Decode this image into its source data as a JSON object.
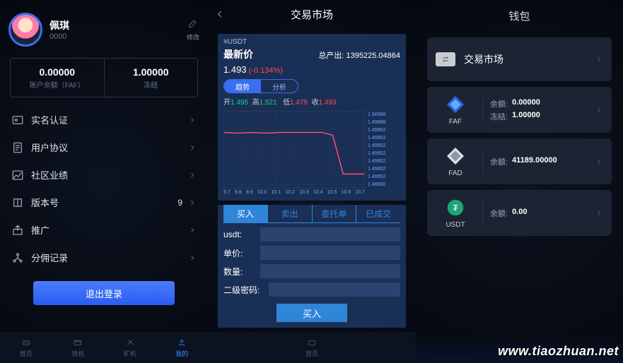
{
  "screen1": {
    "user_name": "佩琪",
    "user_id": "0000",
    "edit_label": "修改",
    "balance_value": "0.00000",
    "balance_label": "账户余额（FAF）",
    "frozen_value": "1.00000",
    "frozen_label": "冻结",
    "menu": [
      {
        "label": "实名认证"
      },
      {
        "label": "用户协议"
      },
      {
        "label": "社区业绩"
      },
      {
        "label": "版本号",
        "badge": "9"
      },
      {
        "label": "推广"
      },
      {
        "label": "分佣记录"
      }
    ],
    "logout_label": "退出登录",
    "tabs": [
      "首页",
      "钱包",
      "矿机",
      "我的"
    ]
  },
  "screen2": {
    "title": "交易市场",
    "pair": "USDT",
    "latest_label": "最新价",
    "output_label": "总产出:",
    "output_value": "1395225.04864",
    "price": "1.493",
    "pct": "(-0.134%)",
    "seg": [
      "趋势",
      "分析"
    ],
    "ohlc": {
      "o_lab": "开",
      "o": "1.495",
      "h_lab": "高",
      "h": "1.521",
      "l_lab": "低",
      "l": "1.479",
      "c_lab": "收",
      "c": "1.493"
    },
    "trade_tabs": [
      "买入",
      "卖出",
      "委托单",
      "已成交"
    ],
    "fields": [
      "usdt:",
      "单价:",
      "数量:",
      "二级密码:"
    ],
    "buy_label": "买入",
    "tabs": [
      "首页"
    ]
  },
  "chart_data": {
    "type": "line",
    "x": [
      "9.7",
      "9.8",
      "9.9",
      "10.0",
      "10.1",
      "10.2",
      "10.3",
      "10.4",
      "10.5",
      "10.6",
      "10.7"
    ],
    "series": [
      {
        "name": "price",
        "values": [
          1.501,
          1.5005,
          1.501,
          1.5008,
          1.501,
          1.501,
          1.501,
          1.501,
          1.499,
          1.48,
          1.48
        ]
      }
    ],
    "y_ticks": [
      "1.50988",
      "1.49988",
      "1.49952",
      "1.49952",
      "1.49952",
      "1.49952",
      "1.49952",
      "1.49952",
      "1.49952",
      "1.48000"
    ],
    "ylim": [
      1.475,
      1.512
    ]
  },
  "screen3": {
    "title": "钱包",
    "market_label": "交易市场",
    "assets": [
      {
        "symbol": "FAF",
        "balance_label": "余额:",
        "balance": "0.00000",
        "frozen_label": "冻结:",
        "frozen": "1.00000",
        "color": "#2a66e8"
      },
      {
        "symbol": "FAD",
        "balance_label": "余额:",
        "balance": "41189.00000",
        "color": "#dcdfe5"
      },
      {
        "symbol": "USDT",
        "balance_label": "余额:",
        "balance": "0.00",
        "color": "#1fa37a"
      }
    ]
  },
  "watermark": "www.tiaozhuan.net"
}
